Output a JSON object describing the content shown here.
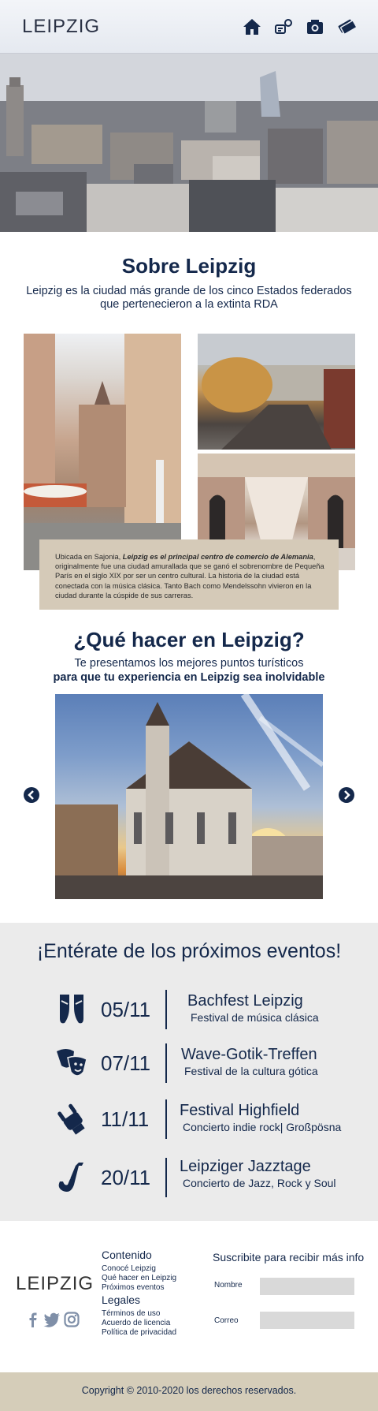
{
  "header": {
    "logo": "LEIPZIG",
    "nav": [
      {
        "icon": "home-icon"
      },
      {
        "icon": "attractions-icon"
      },
      {
        "icon": "camera-icon"
      },
      {
        "icon": "tickets-icon"
      }
    ]
  },
  "about": {
    "title": "Sobre Leipzig",
    "subtitle": "Leipzig es la ciudad más grande de los cinco Estados federados que pertenecieron a la extinta RDA",
    "info_intro": "Ubicada en Sajonia, ",
    "info_bold": "Leipzig es el principal centro de comercio de Alemania",
    "info_rest": ", originalmente fue una ciudad  amurallada que se ganó el sobrenombre de Pequeña París en el siglo XIX por ser un centro cultural. La historia de la ciudad está conectada con la música clásica. Tanto Bach como Mendelssohn vivieron en la ciudad durante la cúspide de sus carreras."
  },
  "que_hacer": {
    "title": "¿Qué hacer en Leipzig?",
    "line1": "Te presentamos los mejores puntos turísticos",
    "line2": "para que tu experiencia en Leipzig sea inolvidable"
  },
  "events": {
    "title": "¡Entérate de los próximos eventos!",
    "items": [
      {
        "icon": "ballet-shoes-icon",
        "date": "05/11",
        "name": "Bachfest Leipzig",
        "sub": "Festival de música clásica"
      },
      {
        "icon": "theater-masks-icon",
        "date": "07/11",
        "name": "Wave-Gotik-Treffen",
        "sub": "Festival de la cultura gótica"
      },
      {
        "icon": "rock-hand-icon",
        "date": "11/11",
        "name": "Festival Highfield",
        "sub": "Concierto indie rock| Großpösna"
      },
      {
        "icon": "saxophone-icon",
        "date": "20/11",
        "name": "Leipziger Jazztage",
        "sub": "Concierto de Jazz, Rock y Soul"
      }
    ]
  },
  "footer": {
    "logo": "LEIPZIG",
    "social": [
      "facebook-icon",
      "twitter-icon",
      "instagram-icon"
    ],
    "contenido_title": "Contenido",
    "contenido_links": [
      "Conocé Leipzig",
      "Qué hacer en Leipzig",
      "Próximos eventos"
    ],
    "legales_title": "Legales",
    "legales_links": [
      "Términos de uso",
      "Acuerdo de licencia",
      "Política de privacidad"
    ],
    "subscribe_title": "Suscribite para recibir más info",
    "name_label": "Nombre",
    "email_label": "Correo",
    "copyright": "Copyright ©  2010-2020 los derechos reservados."
  },
  "colors": {
    "navy": "#14284b",
    "beige": "#d5cab8",
    "events_bg": "#ebebeb",
    "footer_bar": "#d5cdb9"
  }
}
